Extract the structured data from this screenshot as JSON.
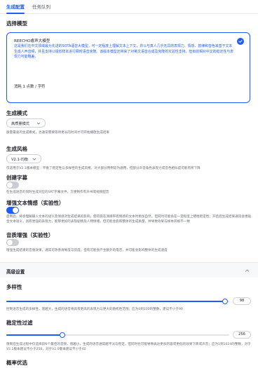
{
  "tabs": [
    {
      "label": "生成配置",
      "active": true
    },
    {
      "label": "任务队列",
      "active": false
    }
  ],
  "model_section": {
    "title": "选择模型",
    "card": {
      "name": "REECHO睿声大模型",
      "description": "这是我们在中文领域最为先进的SOTA语音大模型，可一定程度上理解文本上下文，并以与真人几乎无异的表现力、情感、韵律和音色来基于文本生成人声音频，并且支持以极低样本进行瞬时语音克隆。该版本模型还带来了对英文语音合成及克隆的实验性支持，但目前相对中文的稳定性与表现力可能略差。",
      "cost": "消耗 1 点数 / 字符",
      "selected": true
    }
  },
  "generation_mode": {
    "title": "生成模式",
    "selected": "高质量模式",
    "description": "质量最高的生成模式，也通常需要等待更长的时间才可开始播放生成结果"
  },
  "generation_style": {
    "title": "生成风格",
    "selected": "V2.1-均衡",
    "description": "仅适用于V2.1版本模型｜平衡了稳定性与多样性的生成风格，对大部分用例较为通用，但部分声音角色表现力或音色相似度可能有所下降"
  },
  "subtitle": {
    "title": "创建字幕",
    "enabled": false,
    "description": "在生成语音的同时生成对应的SRT字幕文件，方便制作有声书或视频配音"
  },
  "text_emotion": {
    "title": "增强文本情感（实验性）",
    "enabled": true,
    "description": "启用后，将会理解输入文本的语义及情感对生成结果的影响，使得其在演绎带有情感的文本时更加自然，但同时可能会在一定程度上牺牲稳定性；开启后生成结果通常会更贴合文本语义，具有更强的表现力，能够更好的表现剧情及人物情绪，但可能会影响整体的生成质量，并导致效果与样本风格不一致"
  },
  "audio_enhance": {
    "title": "音质增强（实验性）",
    "enabled": false,
    "description": "增强生成结果的音质效果，通常可改善清晰度与韵度，但有可能会产生额外的电音，并可能会影响整体的生成速度"
  },
  "advanced": {
    "title": "高级设置"
  },
  "diversity": {
    "title": "多样性",
    "value": "98",
    "fraction": 0.98,
    "description": "控制语音生成的多样性，值越大，生成的语音将具有更高的表现力与更大的随机性范围；应为0到100的整数，建议不小于90"
  },
  "stability": {
    "title": "稳定性过滤",
    "value": "256",
    "fraction": 0.25,
    "description": "限制在生成过程中仅选择前N个最佳的音频，值越小，生成的语音通常越平淡与稳定，但同时也可能导致表达更加内容或更低的效果下降或声音；应为1到1024的整数，对于V2.1版本建议不小于256，对于V2.0版本建议不小于40"
  },
  "sampling": {
    "title": "概率优选"
  },
  "colors": {
    "accent": "#1d5cff",
    "toggle_off": "#c9cdd4"
  }
}
